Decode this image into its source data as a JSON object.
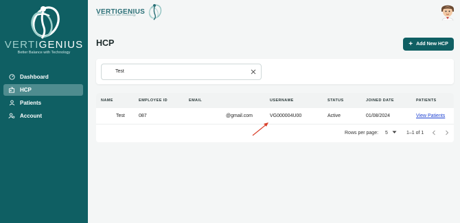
{
  "sidebar": {
    "brand_left": "VERTI",
    "brand_right": "GENIUS",
    "tagline": "Better Balance with Technology",
    "items": [
      {
        "label": "Dashboard",
        "icon": "dashboard-icon",
        "active": false
      },
      {
        "label": "HCP",
        "icon": "hcp-icon",
        "active": true
      },
      {
        "label": "Patients",
        "icon": "patients-icon",
        "active": false
      },
      {
        "label": "Account",
        "icon": "account-icon",
        "active": false
      }
    ]
  },
  "topbar": {
    "brand": "VERTIGENIUS",
    "tagline": "Better Balance with Technology",
    "avatar_icon": "user-avatar-icon"
  },
  "page": {
    "title": "HCP",
    "add_button": "Add New HCP"
  },
  "search": {
    "value": "Test"
  },
  "table": {
    "headers": [
      "NAME",
      "EMPLOYEE ID",
      "EMAIL",
      "USERNAME",
      "STATUS",
      "JOINED DATE",
      "PATIENTS"
    ],
    "rows": [
      {
        "name": "Test",
        "employee_id": "087",
        "email": "@gmail.com",
        "username": "VG000004U00",
        "status": "Active",
        "joined": "01/08/2024",
        "patients": "View Patients"
      }
    ]
  },
  "pagination": {
    "rows_label": "Rows per page:",
    "rows_value": "5",
    "range": "1–1 of 1"
  },
  "colors": {
    "sidebar": "#0f5f63",
    "accent": "#0f5f63",
    "link": "#1a3fd1",
    "annotation": "#d9402b"
  }
}
